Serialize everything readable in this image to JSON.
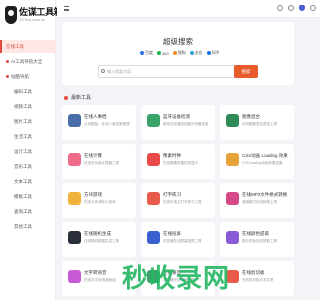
{
  "brand": {
    "title": "佐谋工具箱",
    "subtitle": "ZZTool.com.cn"
  },
  "sidebar": {
    "items": [
      {
        "label": "在线工具",
        "style": "active"
      },
      {
        "label": "AI工具导航大全",
        "style": "dot"
      },
      {
        "label": "站酷导航",
        "style": "dot"
      },
      {
        "label": "编码工具",
        "style": "plain"
      },
      {
        "label": "视频工具",
        "style": "plain"
      },
      {
        "label": "图片工具",
        "style": "plain"
      },
      {
        "label": "生活工具",
        "style": "plain"
      },
      {
        "label": "设计工具",
        "style": "plain"
      },
      {
        "label": "音乐工具",
        "style": "plain"
      },
      {
        "label": "文本工具",
        "style": "plain"
      },
      {
        "label": "模板工具",
        "style": "plain"
      },
      {
        "label": "查询工具",
        "style": "plain"
      },
      {
        "label": "其他工具",
        "style": "plain"
      }
    ]
  },
  "search": {
    "title": "超级搜索",
    "engines": [
      {
        "label": "百度",
        "color": "#2f6fe0"
      },
      {
        "label": "360",
        "color": "#19b34a"
      },
      {
        "label": "搜狗",
        "color": "#f08a24"
      },
      {
        "label": "必应",
        "color": "#2a9de0"
      },
      {
        "label": "知乎",
        "color": "#0c71e0"
      }
    ],
    "placeholder": "输入搜索内容...",
    "button_label": "搜索"
  },
  "section": {
    "title": "最新工具"
  },
  "tools": [
    {
      "title": "在线人事档",
      "desc": "公司模板，在线人事档案管理",
      "color": "#4a6fa8"
    },
    {
      "title": "蓝牙设备检测",
      "desc": "使用浏览器检测蓝牙设备信息",
      "color": "#3aa36a"
    },
    {
      "title": "图像混合",
      "desc": "在线图像混合叠加工具",
      "color": "#2e8b57"
    },
    {
      "title": "在线计算",
      "desc": "在线多功能计算器工具",
      "color": "#f06a8a"
    },
    {
      "title": "像素时钟",
      "desc": "在线像素风格时钟显示",
      "color": "#e84a4a"
    },
    {
      "title": "CSS动画 Loading 效果",
      "desc": "CSS loading动画效果合集",
      "color": "#e8a23a"
    },
    {
      "title": "方块游戏",
      "desc": "在线方块消除小游戏",
      "color": "#f0b23a"
    },
    {
      "title": "打字练习",
      "desc": "在线中英文打字练习工具",
      "color": "#e85a4a"
    },
    {
      "title": "在线MP3文件格式转换",
      "desc": "音频格式在线转换工具",
      "color": "#d64a8a"
    },
    {
      "title": "在线随机生成",
      "desc": "在线随机数据生成工具",
      "color": "#2a2f3a"
    },
    {
      "title": "在线投屏",
      "desc": "浏览器在线屏幕投屏工具",
      "color": "#3a5fd0"
    },
    {
      "title": "在线颜色提取",
      "desc": "图片颜色在线提取工具",
      "color": "#8a5ad6"
    },
    {
      "title": "文字转语音",
      "desc": "在线文字转语音朗读",
      "color": "#c85ad6"
    },
    {
      "title": "在线录音",
      "desc": "浏览器在线录音工具",
      "color": "#3aa36a"
    },
    {
      "title": "在线剪切板",
      "desc": "在线剪切板文本共享",
      "color": "#e85a4a"
    }
  ],
  "watermark": "秒收录网",
  "colors": {
    "accent": "#e14b3b",
    "search_button": "#e85b2d",
    "watermark": "#25b864"
  }
}
